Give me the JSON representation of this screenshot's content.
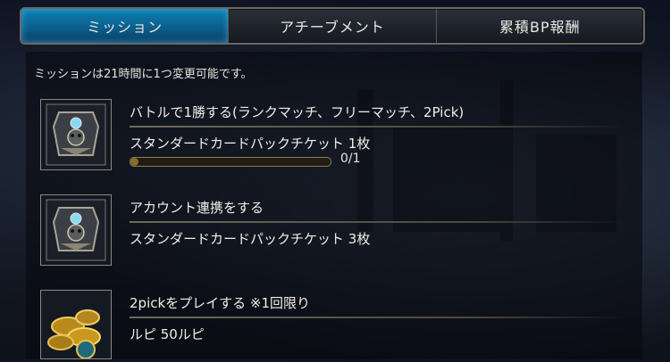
{
  "tabs": [
    {
      "label": "ミッション",
      "active": true
    },
    {
      "label": "アチーブメント",
      "active": false
    },
    {
      "label": "累積BP報酬",
      "active": false
    }
  ],
  "notice": "ミッションは21時間に1つ変更可能です。",
  "missions": [
    {
      "title": "バトルで1勝する(ランクマッチ、フリーマッチ、2Pick)",
      "reward": "スタンダードカードパックチケット 1枚",
      "progress_label": "0/1",
      "progress_fraction": 0,
      "icon": "card-pack-ticket-icon"
    },
    {
      "title": "アカウント連携をする",
      "reward": "スタンダードカードパックチケット 3枚",
      "icon": "card-pack-ticket-icon"
    },
    {
      "title": "2pickをプレイする ※1回限り",
      "reward": "ルピ 50ルピ",
      "icon": "rupee-coins-icon"
    }
  ],
  "colors": {
    "active_tab": "#0d7fb3",
    "progress_fill": "#c9a245"
  }
}
